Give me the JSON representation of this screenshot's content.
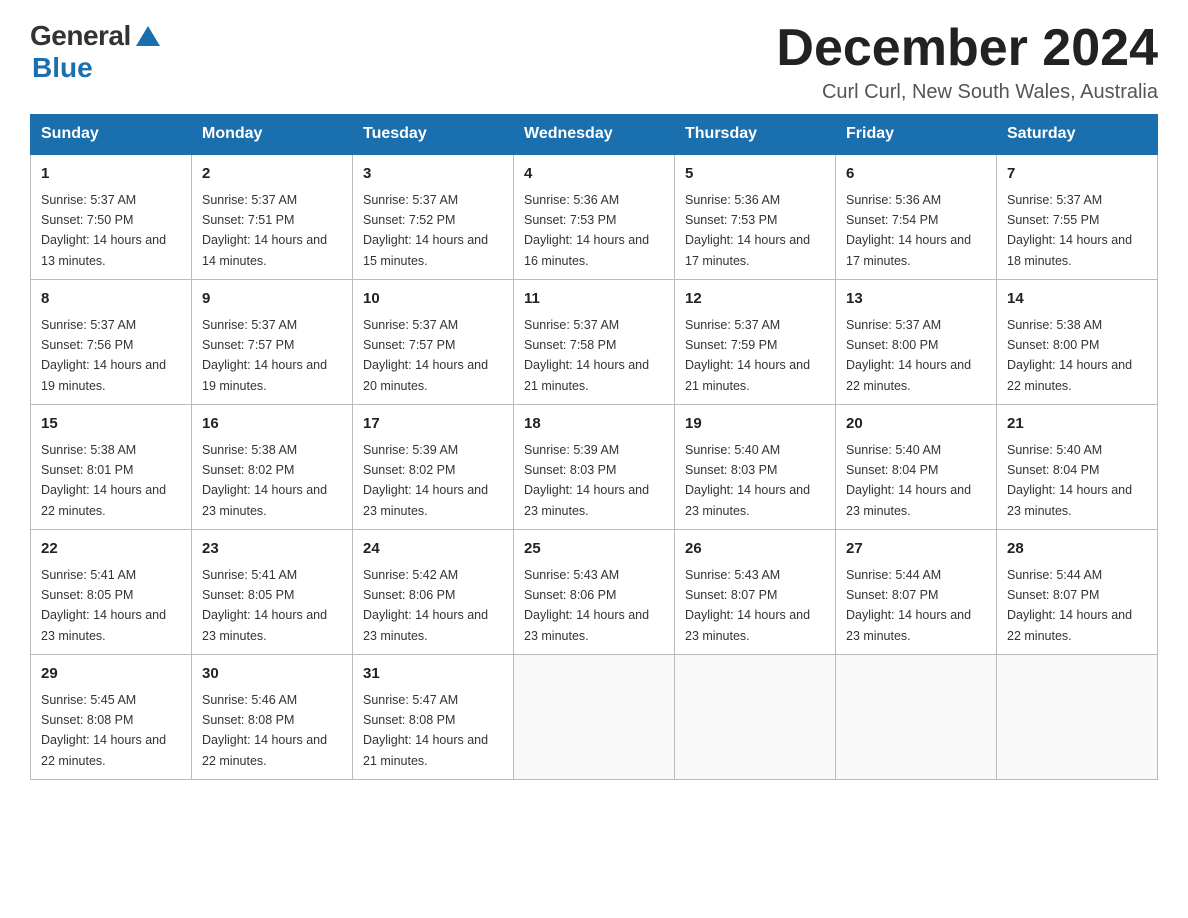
{
  "header": {
    "logo_general": "General",
    "logo_blue": "Blue",
    "month_title": "December 2024",
    "location": "Curl Curl, New South Wales, Australia"
  },
  "weekdays": [
    "Sunday",
    "Monday",
    "Tuesday",
    "Wednesday",
    "Thursday",
    "Friday",
    "Saturday"
  ],
  "weeks": [
    [
      {
        "day": "1",
        "sunrise": "5:37 AM",
        "sunset": "7:50 PM",
        "daylight": "14 hours and 13 minutes."
      },
      {
        "day": "2",
        "sunrise": "5:37 AM",
        "sunset": "7:51 PM",
        "daylight": "14 hours and 14 minutes."
      },
      {
        "day": "3",
        "sunrise": "5:37 AM",
        "sunset": "7:52 PM",
        "daylight": "14 hours and 15 minutes."
      },
      {
        "day": "4",
        "sunrise": "5:36 AM",
        "sunset": "7:53 PM",
        "daylight": "14 hours and 16 minutes."
      },
      {
        "day": "5",
        "sunrise": "5:36 AM",
        "sunset": "7:53 PM",
        "daylight": "14 hours and 17 minutes."
      },
      {
        "day": "6",
        "sunrise": "5:36 AM",
        "sunset": "7:54 PM",
        "daylight": "14 hours and 17 minutes."
      },
      {
        "day": "7",
        "sunrise": "5:37 AM",
        "sunset": "7:55 PM",
        "daylight": "14 hours and 18 minutes."
      }
    ],
    [
      {
        "day": "8",
        "sunrise": "5:37 AM",
        "sunset": "7:56 PM",
        "daylight": "14 hours and 19 minutes."
      },
      {
        "day": "9",
        "sunrise": "5:37 AM",
        "sunset": "7:57 PM",
        "daylight": "14 hours and 19 minutes."
      },
      {
        "day": "10",
        "sunrise": "5:37 AM",
        "sunset": "7:57 PM",
        "daylight": "14 hours and 20 minutes."
      },
      {
        "day": "11",
        "sunrise": "5:37 AM",
        "sunset": "7:58 PM",
        "daylight": "14 hours and 21 minutes."
      },
      {
        "day": "12",
        "sunrise": "5:37 AM",
        "sunset": "7:59 PM",
        "daylight": "14 hours and 21 minutes."
      },
      {
        "day": "13",
        "sunrise": "5:37 AM",
        "sunset": "8:00 PM",
        "daylight": "14 hours and 22 minutes."
      },
      {
        "day": "14",
        "sunrise": "5:38 AM",
        "sunset": "8:00 PM",
        "daylight": "14 hours and 22 minutes."
      }
    ],
    [
      {
        "day": "15",
        "sunrise": "5:38 AM",
        "sunset": "8:01 PM",
        "daylight": "14 hours and 22 minutes."
      },
      {
        "day": "16",
        "sunrise": "5:38 AM",
        "sunset": "8:02 PM",
        "daylight": "14 hours and 23 minutes."
      },
      {
        "day": "17",
        "sunrise": "5:39 AM",
        "sunset": "8:02 PM",
        "daylight": "14 hours and 23 minutes."
      },
      {
        "day": "18",
        "sunrise": "5:39 AM",
        "sunset": "8:03 PM",
        "daylight": "14 hours and 23 minutes."
      },
      {
        "day": "19",
        "sunrise": "5:40 AM",
        "sunset": "8:03 PM",
        "daylight": "14 hours and 23 minutes."
      },
      {
        "day": "20",
        "sunrise": "5:40 AM",
        "sunset": "8:04 PM",
        "daylight": "14 hours and 23 minutes."
      },
      {
        "day": "21",
        "sunrise": "5:40 AM",
        "sunset": "8:04 PM",
        "daylight": "14 hours and 23 minutes."
      }
    ],
    [
      {
        "day": "22",
        "sunrise": "5:41 AM",
        "sunset": "8:05 PM",
        "daylight": "14 hours and 23 minutes."
      },
      {
        "day": "23",
        "sunrise": "5:41 AM",
        "sunset": "8:05 PM",
        "daylight": "14 hours and 23 minutes."
      },
      {
        "day": "24",
        "sunrise": "5:42 AM",
        "sunset": "8:06 PM",
        "daylight": "14 hours and 23 minutes."
      },
      {
        "day": "25",
        "sunrise": "5:43 AM",
        "sunset": "8:06 PM",
        "daylight": "14 hours and 23 minutes."
      },
      {
        "day": "26",
        "sunrise": "5:43 AM",
        "sunset": "8:07 PM",
        "daylight": "14 hours and 23 minutes."
      },
      {
        "day": "27",
        "sunrise": "5:44 AM",
        "sunset": "8:07 PM",
        "daylight": "14 hours and 23 minutes."
      },
      {
        "day": "28",
        "sunrise": "5:44 AM",
        "sunset": "8:07 PM",
        "daylight": "14 hours and 22 minutes."
      }
    ],
    [
      {
        "day": "29",
        "sunrise": "5:45 AM",
        "sunset": "8:08 PM",
        "daylight": "14 hours and 22 minutes."
      },
      {
        "day": "30",
        "sunrise": "5:46 AM",
        "sunset": "8:08 PM",
        "daylight": "14 hours and 22 minutes."
      },
      {
        "day": "31",
        "sunrise": "5:47 AM",
        "sunset": "8:08 PM",
        "daylight": "14 hours and 21 minutes."
      },
      null,
      null,
      null,
      null
    ]
  ],
  "labels": {
    "sunrise_prefix": "Sunrise: ",
    "sunset_prefix": "Sunset: ",
    "daylight_prefix": "Daylight: "
  }
}
